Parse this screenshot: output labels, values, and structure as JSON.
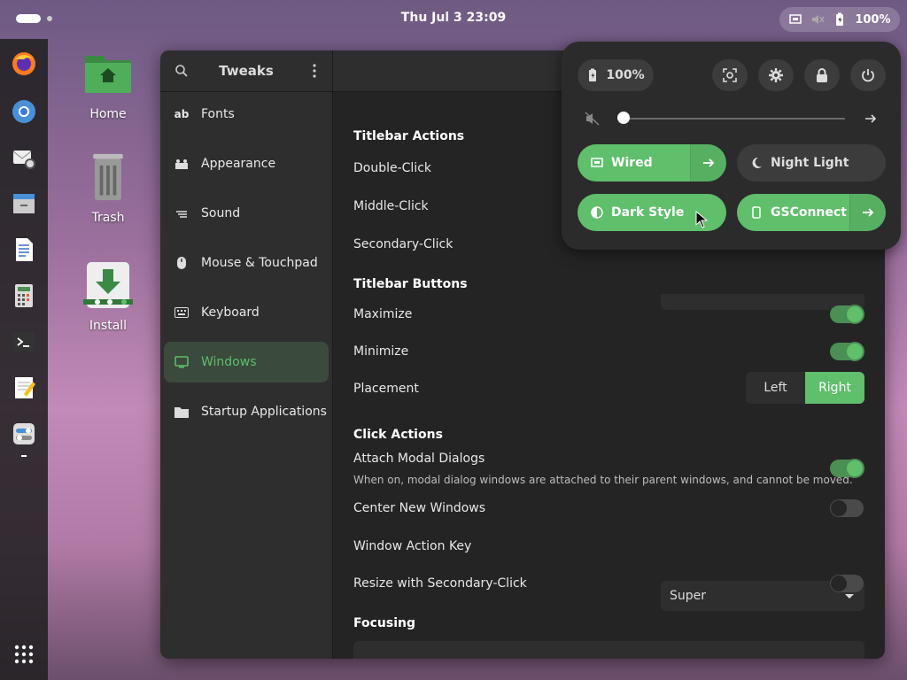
{
  "topbar": {
    "clock": "Thu Jul 3  23:09",
    "battery": "100%"
  },
  "desktop": {
    "icons": [
      {
        "label": "Home"
      },
      {
        "label": "Trash"
      },
      {
        "label": "Install"
      }
    ]
  },
  "tweaks": {
    "sidebar_title": "Tweaks",
    "sidebar": [
      {
        "label": "Fonts",
        "icon": "fonts-icon"
      },
      {
        "label": "Appearance",
        "icon": "appearance-icon"
      },
      {
        "label": "Sound",
        "icon": "sound-icon"
      },
      {
        "label": "Mouse & Touchpad",
        "icon": "mouse-icon"
      },
      {
        "label": "Keyboard",
        "icon": "keyboard-icon"
      },
      {
        "label": "Windows",
        "icon": "windows-icon"
      },
      {
        "label": "Startup Applications",
        "icon": "folder-icon"
      }
    ],
    "sections": {
      "titlebar_actions": "Titlebar Actions",
      "double_click": "Double-Click",
      "middle_click": "Middle-Click",
      "secondary_click": "Secondary-Click",
      "titlebar_buttons": "Titlebar Buttons",
      "maximize": "Maximize",
      "minimize": "Minimize",
      "placement": "Placement",
      "placement_left": "Left",
      "placement_right": "Right",
      "click_actions": "Click Actions",
      "attach_modal": "Attach Modal Dialogs",
      "attach_modal_desc": "When on, modal dialog windows are attached to their parent windows, and cannot be moved.",
      "center_new": "Center New Windows",
      "window_action_key": "Window Action Key",
      "window_action_key_value": "Super",
      "resize_secondary": "Resize with Secondary-Click",
      "focusing": "Focusing"
    }
  },
  "quick_settings": {
    "battery": "100%",
    "wired": "Wired",
    "night_light": "Night Light",
    "dark_style": "Dark Style",
    "gsconnect": "GSConnect"
  },
  "colors": {
    "accent": "#5fbf6b"
  }
}
